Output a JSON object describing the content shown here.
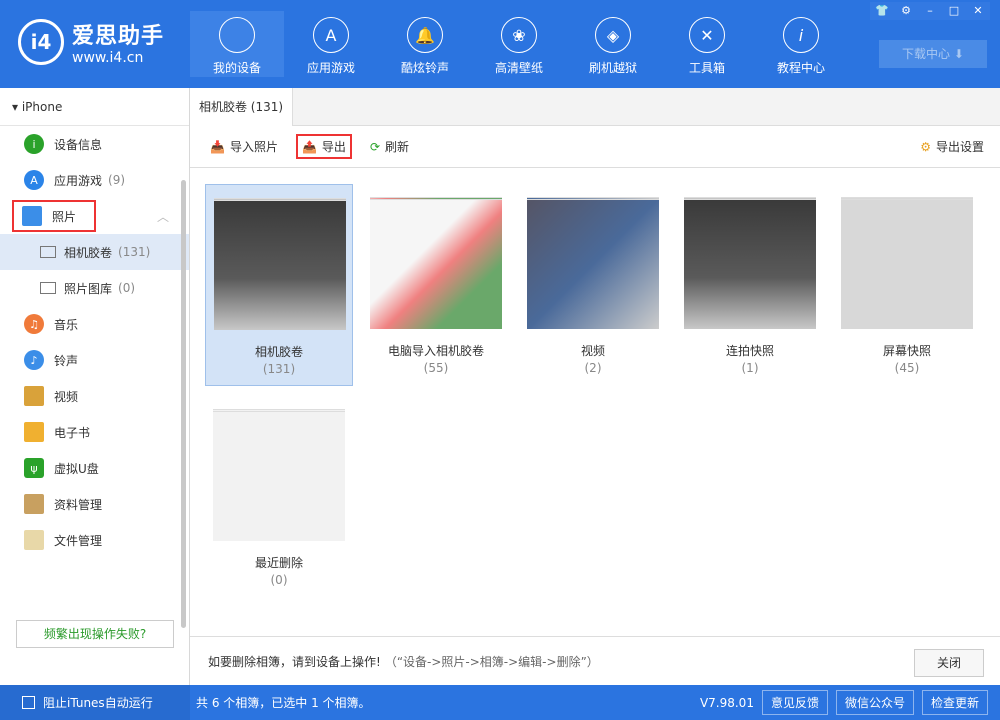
{
  "header": {
    "logo_title": "爱思助手",
    "logo_url": "www.i4.cn",
    "logo_mark": "i4",
    "nav": [
      {
        "label": "我的设备",
        "icon": "apple-icon"
      },
      {
        "label": "应用游戏",
        "icon": "appstore-icon"
      },
      {
        "label": "酷炫铃声",
        "icon": "bell-icon"
      },
      {
        "label": "高清壁纸",
        "icon": "flower-icon"
      },
      {
        "label": "刷机越狱",
        "icon": "box-icon"
      },
      {
        "label": "工具箱",
        "icon": "tools-icon"
      },
      {
        "label": "教程中心",
        "icon": "info-icon"
      }
    ],
    "download": "下载中心"
  },
  "sidebar": {
    "device": "iPhone",
    "items": [
      {
        "label": "设备信息"
      },
      {
        "label": "应用游戏",
        "count": "(9)"
      },
      {
        "label": "照片"
      },
      {
        "label": "相机胶卷",
        "count": "(131)"
      },
      {
        "label": "照片图库",
        "count": "(0)"
      },
      {
        "label": "音乐"
      },
      {
        "label": "铃声"
      },
      {
        "label": "视频"
      },
      {
        "label": "电子书"
      },
      {
        "label": "虚拟U盘"
      },
      {
        "label": "资料管理"
      },
      {
        "label": "文件管理"
      }
    ],
    "fail_button": "频繁出现操作失败?"
  },
  "main": {
    "tab": "相机胶卷 (131)",
    "toolbar": {
      "import": "导入照片",
      "export": "导出",
      "refresh": "刷新",
      "settings": "导出设置"
    },
    "albums": [
      {
        "name": "相机胶卷",
        "count": "(131)"
      },
      {
        "name": "电脑导入相机胶卷",
        "count": "(55)"
      },
      {
        "name": "视频",
        "count": "(2)"
      },
      {
        "name": "连拍快照",
        "count": "(1)"
      },
      {
        "name": "屏幕快照",
        "count": "(45)"
      },
      {
        "name": "最近删除",
        "count": "(0)"
      }
    ],
    "hint_bold": "如要删除相簿，请到设备上操作!",
    "hint": "（“设备->照片->相簿->编辑->删除”）",
    "close": "关闭"
  },
  "status": {
    "itunes": "阻止iTunes自动运行",
    "summary": "共 6 个相簿，已选中 1 个相簿。",
    "version": "V7.98.01",
    "feedback": "意见反馈",
    "wechat": "微信公众号",
    "update": "检查更新"
  }
}
